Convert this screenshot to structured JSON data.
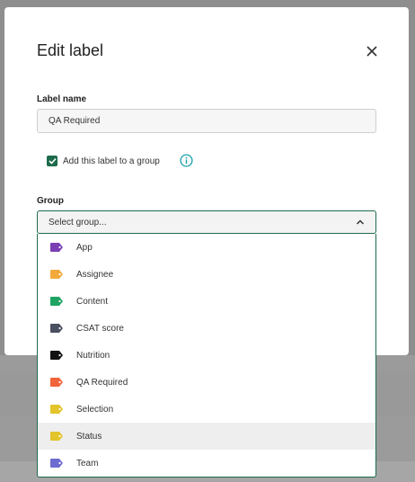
{
  "modal": {
    "title": "Edit label",
    "label_name_heading": "Label name",
    "label_name_value": "QA Required",
    "add_to_group_label": "Add this label to a group",
    "add_to_group_checked": true,
    "group_heading": "Group",
    "group_select_placeholder": "Select group..."
  },
  "group_options": [
    {
      "label": "App",
      "color": "#7b3fb5"
    },
    {
      "label": "Assignee",
      "color": "#f2a93b"
    },
    {
      "label": "Content",
      "color": "#1fa463"
    },
    {
      "label": "CSAT score",
      "color": "#4a5060"
    },
    {
      "label": "Nutrition",
      "color": "#111111"
    },
    {
      "label": "QA Required",
      "color": "#f2643b"
    },
    {
      "label": "Selection",
      "color": "#e3c42b"
    },
    {
      "label": "Status",
      "color": "#e3c42b"
    },
    {
      "label": "Team",
      "color": "#6f6ccf"
    }
  ],
  "hovered_option": "Status",
  "colors": {
    "accent_green": "#1d6b4a",
    "info_teal": "#1aa0a8"
  },
  "icons": {
    "close": "close-icon",
    "check": "checkmark-icon",
    "info": "info-circle-icon",
    "chevron": "chevron-up-icon",
    "tag": "tag-icon"
  }
}
